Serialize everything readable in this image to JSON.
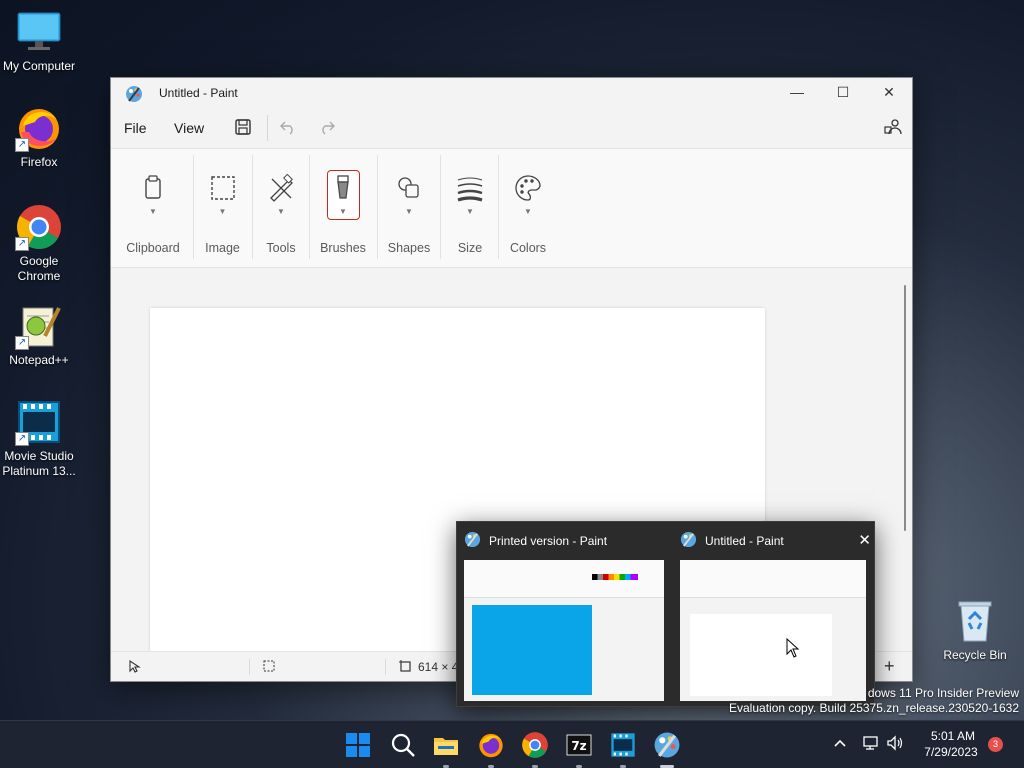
{
  "desktop": {
    "icons": [
      {
        "label": "My Computer",
        "icon": "monitor-icon"
      },
      {
        "label": "Firefox",
        "icon": "firefox-icon"
      },
      {
        "label": "Google Chrome",
        "icon": "chrome-icon"
      },
      {
        "label": "Notepad++",
        "icon": "notepadpp-icon"
      },
      {
        "label": "Movie Studio Platinum 13...",
        "icon": "movie-studio-icon"
      },
      {
        "label": "Recycle Bin",
        "icon": "recycle-bin-icon"
      }
    ]
  },
  "paint": {
    "title": "Untitled - Paint",
    "menu": {
      "file": "File",
      "view": "View"
    },
    "ribbon": {
      "groups": [
        "Clipboard",
        "Image",
        "Tools",
        "Brushes",
        "Shapes",
        "Size",
        "Colors"
      ]
    },
    "status": {
      "canvas_size": "614 × 4"
    }
  },
  "previews": [
    {
      "title": "Printed version - Paint"
    },
    {
      "title": "Untitled - Paint"
    }
  ],
  "watermark": {
    "line1": "dows 11 Pro Insider Preview",
    "line2": "Evaluation copy. Build 25375.zn_release.230520-1632"
  },
  "taskbar": {
    "time": "5:01 AM",
    "date": "7/29/2023",
    "notification_count": "3",
    "apps": [
      "start",
      "search",
      "file-explorer",
      "firefox",
      "chrome",
      "7zip",
      "movie-studio",
      "paint"
    ]
  },
  "colors": {
    "accent_red": "#c42b1c",
    "preview_blue": "#0aa5e8",
    "start_blue": "#1a8cf0"
  }
}
